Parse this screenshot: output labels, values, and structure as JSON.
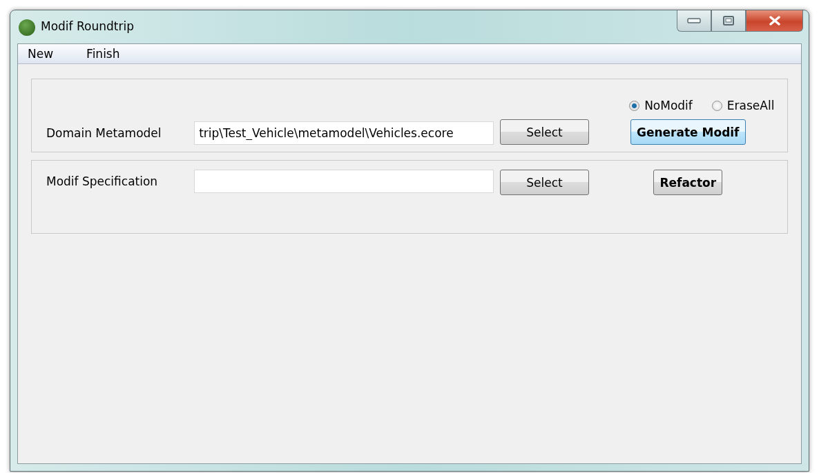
{
  "window": {
    "title": "Modif Roundtrip"
  },
  "menu": [
    "New",
    "Finish"
  ],
  "panels": [
    {
      "label": "Domain Metamodel",
      "value": "trip\\Test_Vehicle\\metamodel\\Vehicles.ecore",
      "select": "Select",
      "radios": [
        {
          "label": "NoModif",
          "selected": true
        },
        {
          "label": "EraseAll",
          "selected": false
        }
      ],
      "action": {
        "label": "Generate Modif",
        "focused": true
      }
    },
    {
      "label": "Modif Specification",
      "select": "Select",
      "action": {
        "label": "Refactor",
        "focused": false
      }
    }
  ]
}
